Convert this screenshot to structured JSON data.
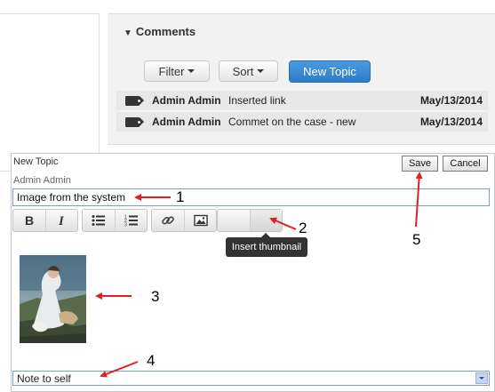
{
  "comments": {
    "header": "Comments",
    "filter_label": "Filter",
    "sort_label": "Sort",
    "new_topic_label": "New Topic",
    "rows": [
      {
        "author": "Admin Admin",
        "text": "Inserted link",
        "date": "May/13/2014"
      },
      {
        "author": "Admin Admin",
        "text": "Commet on the case - new",
        "date": "May/13/2014"
      }
    ]
  },
  "new_topic": {
    "label": "New Topic",
    "author": "Admin Admin",
    "save_label": "Save",
    "cancel_label": "Cancel",
    "title_value": "Image from the system",
    "tooltip": "Insert thumbnail",
    "select_value": "Note to self"
  },
  "toolbar_icons": [
    "bold-icon",
    "italic-icon",
    "bullet-list-icon",
    "numbered-list-icon",
    "link-icon",
    "image-icon",
    "insert-thumbnail-button"
  ],
  "annotations": {
    "n1": "1",
    "n2": "2",
    "n3": "3",
    "n4": "4",
    "n5": "5"
  },
  "colors": {
    "primary_button": "#3a86d0",
    "annotation_arrow": "#e02020",
    "tooltip_bg": "#333333"
  }
}
